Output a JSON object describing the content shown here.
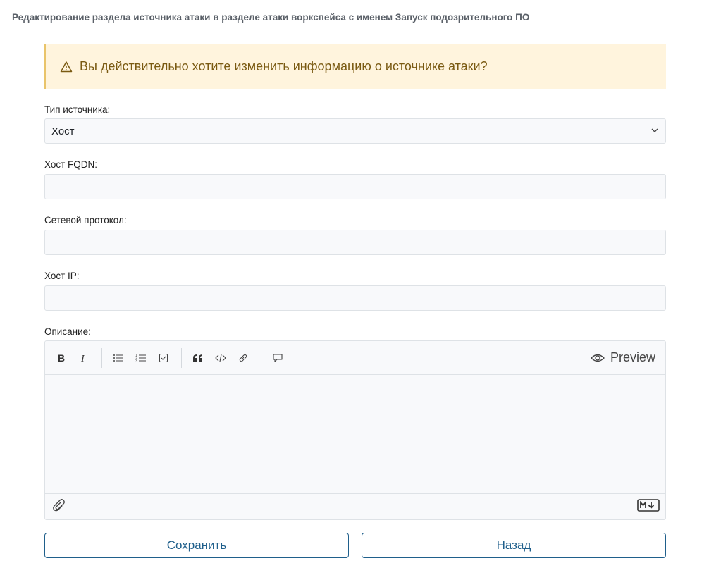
{
  "page": {
    "title": "Редактирование раздела источника атаки в разделе атаки воркспейса с именем Запуск подозрительного ПО"
  },
  "alert": {
    "icon": "warning-triangle-icon",
    "text": "Вы действительно хотите изменить информацию о источнике атаки?",
    "colors": {
      "background": "#fff4dd",
      "border": "#e9c46a",
      "text": "#7a5a12"
    }
  },
  "form": {
    "source_type": {
      "label": "Тип источника:",
      "value": "Хост"
    },
    "host_fqdn": {
      "label": "Хост FQDN:",
      "value": "",
      "placeholder": ""
    },
    "network_protocol": {
      "label": "Сетевой протокол:",
      "value": "",
      "placeholder": ""
    },
    "host_ip": {
      "label": "Хост IP:",
      "value": "",
      "placeholder": ""
    },
    "description": {
      "label": "Описание:",
      "toolbar": [
        "bold-icon",
        "italic-icon",
        "unordered-list-icon",
        "ordered-list-icon",
        "task-list-icon",
        "quote-icon",
        "code-icon",
        "link-icon",
        "comment-icon"
      ],
      "preview_label": "Preview",
      "value": ""
    }
  },
  "buttons": {
    "save": "Сохранить",
    "back": "Назад"
  },
  "colors": {
    "accent": "#1f5f8b"
  }
}
